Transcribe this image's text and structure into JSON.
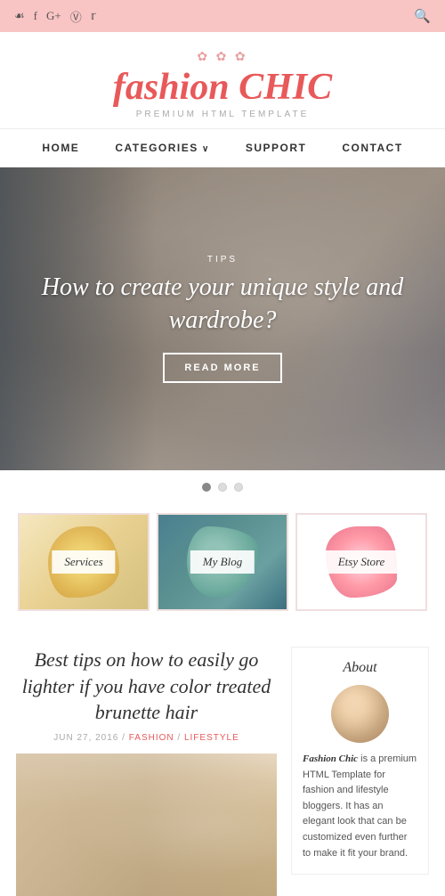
{
  "topbar": {
    "social_icons": [
      "inst-icon",
      "fb-icon",
      "gplus-icon",
      "pinterest-icon",
      "twitter-icon"
    ],
    "search_icon": "search-icon"
  },
  "logo": {
    "decoration": "✿ ✿ ✿",
    "title_plain": "fashion ",
    "title_accent": "CHIC",
    "subtitle": "PREMIUM HTML TEMPLATE"
  },
  "nav": {
    "items": [
      {
        "label": "HOME",
        "has_arrow": false
      },
      {
        "label": "CATEGORIES",
        "has_arrow": true
      },
      {
        "label": "SUPPORT",
        "has_arrow": false
      },
      {
        "label": "CONTACT",
        "has_arrow": false
      }
    ]
  },
  "hero": {
    "tag": "TIPS",
    "title": "How to create your unique style and wardrobe?",
    "button_label": "READ MORE"
  },
  "slider": {
    "dots": [
      true,
      false,
      false
    ]
  },
  "featured": {
    "boxes": [
      {
        "label": "Services"
      },
      {
        "label": "My Blog"
      },
      {
        "label": "Etsy Store"
      }
    ]
  },
  "blog": {
    "post_title": "Best tips on how to easily go lighter if you have color treated brunette hair",
    "meta": {
      "date": "JUN 27, 2016",
      "slash": " / ",
      "category": "FASHION",
      "slash2": " / ",
      "category2": "LIFESTYLE"
    }
  },
  "sidebar": {
    "about_title": "About",
    "about_text_brand": "Fashion Chic",
    "about_text_body": " is a premium HTML Template for fashion and lifestyle bloggers. It has an elegant look that can be customized even further to make it fit your brand."
  }
}
